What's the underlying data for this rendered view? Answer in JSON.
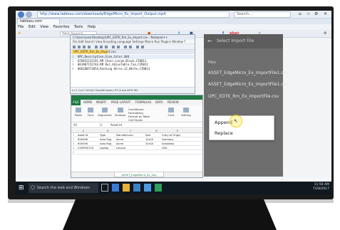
{
  "browser": {
    "url": "http://www.tableau.com/downloads/EdgeMicro_Ex_Import_Output.mp4",
    "search_placeholder": "Search...",
    "tab_label": "tableau.com",
    "menu": [
      "File",
      "Edit",
      "View",
      "Favorites",
      "Tools",
      "Help"
    ],
    "favorites": {
      "search": "Web Search",
      "twitter": "t",
      "facebook": "f",
      "ebay": "ebay"
    }
  },
  "notepad": {
    "title": "C:\\Users\\user\\Desktop\\UPC_EDTK_Rm_Ex_Import.csv - Notepad++",
    "menu": "File Edit Search View Encoding Language Settings Macro Run Plugins Window ?",
    "tab": "UPC_EDTK_Rm_Ex_Import.csv",
    "lines": [
      {
        "n": "1",
        "text": "UPC,Description,Size,Color,SKU"
      },
      {
        "n": "2",
        "text": "076815131191,RM Chair,Large,Black,CIR011"
      },
      {
        "n": "3",
        "text": "061907152744,RM Bar,Adjustable,Tan,CIR012"
      },
      {
        "n": "4",
        "text": "066180571854,Rocking Horse,12,White,CIR013"
      }
    ],
    "status": "Ln:1  Col:1  Sel:0|0        Dos\\Windows      UTF-8 w/o BOM      INS"
  },
  "excel": {
    "file_tab": "FILE",
    "tabs": [
      "HOME",
      "INSERT",
      "PAGE LAYOUT",
      "FORMULAS",
      "DATA",
      "REVIEW"
    ],
    "ribbon": [
      "Paste",
      "Font",
      "Alignment",
      "Number",
      "Conditional Formatting",
      "Format as Table",
      "Cell Styles",
      "Cells",
      "Editing"
    ],
    "name_box": "A1",
    "formula": "Asset Id",
    "columns": [
      "A",
      "B",
      "C",
      "D",
      "E"
    ],
    "rows": [
      {
        "n": "1",
        "cells": [
          "Asset Id",
          "Type",
          "Manufacturer",
          "Size",
          "Cntry of Origin"
        ]
      },
      {
        "n": "2",
        "cells": [
          "R00096",
          "Area Rug",
          "Acme",
          "10x10",
          "Germany"
        ]
      },
      {
        "n": "3",
        "cells": [
          "R00096",
          "Area Rug",
          "Acme",
          "10x10",
          "Indonesia"
        ]
      },
      {
        "n": "4",
        "cells": [
          "COMP45703",
          "Laptop",
          "Lenovo",
          "",
          "USA"
        ]
      },
      {
        "n": "5",
        "cells": [
          "",
          "",
          "",
          "",
          ""
        ]
      }
    ],
    "sheet_tab": "ASSET_EdgeMicro_Ex_Imp"
  },
  "panel": {
    "back_arrow": "←",
    "title": "Select Import File",
    "files_label": "Files",
    "files": [
      "ASSET_EdgeMicro_Ex_ImportFile1.csv",
      "ASSET_EdgeMicro_Ex_ImportFile1.csv",
      "UPC_EDTK_Rm_Ex_ImportFile.csv"
    ]
  },
  "popup": {
    "items": [
      "Append",
      "Replace"
    ]
  },
  "taskbar": {
    "search_placeholder": "Search the web and Windows",
    "time": "11:56 AM",
    "date": "7/28/2017"
  }
}
